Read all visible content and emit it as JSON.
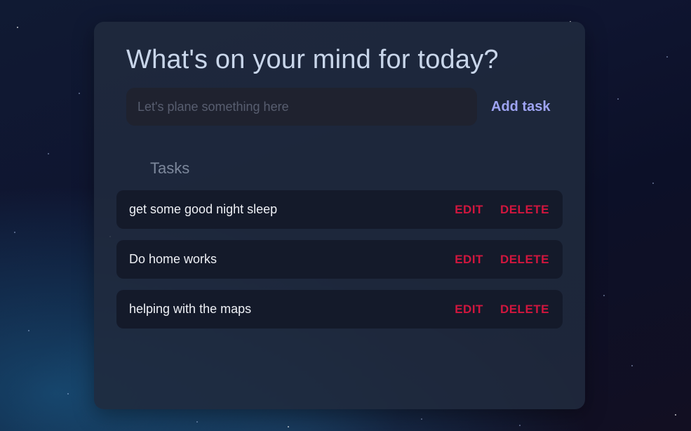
{
  "main": {
    "title": "What's on your mind for today?",
    "input": {
      "value": "",
      "placeholder": "Let's plane something here"
    },
    "add_button_label": "Add task",
    "tasks_heading": "Tasks",
    "tasks": [
      {
        "text": "get some good night sleep",
        "edit_label": "EDIT",
        "delete_label": "DELETE"
      },
      {
        "text": "Do home works",
        "edit_label": "EDIT",
        "delete_label": "DELETE"
      },
      {
        "text": "helping with the maps",
        "edit_label": "EDIT",
        "delete_label": "DELETE"
      }
    ]
  },
  "colors": {
    "card_background": "#202a3d",
    "title_text": "#c9d6ea",
    "add_button": "#9ea4f3",
    "action_red": "#d1163e",
    "task_row_background": "#141a2a"
  }
}
